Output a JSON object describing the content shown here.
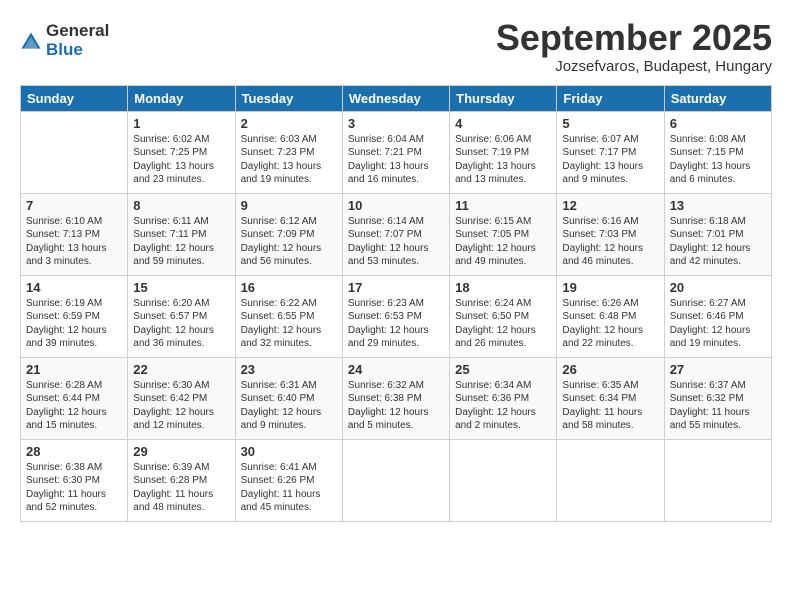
{
  "logo": {
    "general": "General",
    "blue": "Blue"
  },
  "title": "September 2025",
  "location": "Jozsefvaros, Budapest, Hungary",
  "header_days": [
    "Sunday",
    "Monday",
    "Tuesday",
    "Wednesday",
    "Thursday",
    "Friday",
    "Saturday"
  ],
  "weeks": [
    [
      {
        "day": "",
        "data": ""
      },
      {
        "day": "1",
        "data": "Sunrise: 6:02 AM\nSunset: 7:25 PM\nDaylight: 13 hours\nand 23 minutes."
      },
      {
        "day": "2",
        "data": "Sunrise: 6:03 AM\nSunset: 7:23 PM\nDaylight: 13 hours\nand 19 minutes."
      },
      {
        "day": "3",
        "data": "Sunrise: 6:04 AM\nSunset: 7:21 PM\nDaylight: 13 hours\nand 16 minutes."
      },
      {
        "day": "4",
        "data": "Sunrise: 6:06 AM\nSunset: 7:19 PM\nDaylight: 13 hours\nand 13 minutes."
      },
      {
        "day": "5",
        "data": "Sunrise: 6:07 AM\nSunset: 7:17 PM\nDaylight: 13 hours\nand 9 minutes."
      },
      {
        "day": "6",
        "data": "Sunrise: 6:08 AM\nSunset: 7:15 PM\nDaylight: 13 hours\nand 6 minutes."
      }
    ],
    [
      {
        "day": "7",
        "data": "Sunrise: 6:10 AM\nSunset: 7:13 PM\nDaylight: 13 hours\nand 3 minutes."
      },
      {
        "day": "8",
        "data": "Sunrise: 6:11 AM\nSunset: 7:11 PM\nDaylight: 12 hours\nand 59 minutes."
      },
      {
        "day": "9",
        "data": "Sunrise: 6:12 AM\nSunset: 7:09 PM\nDaylight: 12 hours\nand 56 minutes."
      },
      {
        "day": "10",
        "data": "Sunrise: 6:14 AM\nSunset: 7:07 PM\nDaylight: 12 hours\nand 53 minutes."
      },
      {
        "day": "11",
        "data": "Sunrise: 6:15 AM\nSunset: 7:05 PM\nDaylight: 12 hours\nand 49 minutes."
      },
      {
        "day": "12",
        "data": "Sunrise: 6:16 AM\nSunset: 7:03 PM\nDaylight: 12 hours\nand 46 minutes."
      },
      {
        "day": "13",
        "data": "Sunrise: 6:18 AM\nSunset: 7:01 PM\nDaylight: 12 hours\nand 42 minutes."
      }
    ],
    [
      {
        "day": "14",
        "data": "Sunrise: 6:19 AM\nSunset: 6:59 PM\nDaylight: 12 hours\nand 39 minutes."
      },
      {
        "day": "15",
        "data": "Sunrise: 6:20 AM\nSunset: 6:57 PM\nDaylight: 12 hours\nand 36 minutes."
      },
      {
        "day": "16",
        "data": "Sunrise: 6:22 AM\nSunset: 6:55 PM\nDaylight: 12 hours\nand 32 minutes."
      },
      {
        "day": "17",
        "data": "Sunrise: 6:23 AM\nSunset: 6:53 PM\nDaylight: 12 hours\nand 29 minutes."
      },
      {
        "day": "18",
        "data": "Sunrise: 6:24 AM\nSunset: 6:50 PM\nDaylight: 12 hours\nand 26 minutes."
      },
      {
        "day": "19",
        "data": "Sunrise: 6:26 AM\nSunset: 6:48 PM\nDaylight: 12 hours\nand 22 minutes."
      },
      {
        "day": "20",
        "data": "Sunrise: 6:27 AM\nSunset: 6:46 PM\nDaylight: 12 hours\nand 19 minutes."
      }
    ],
    [
      {
        "day": "21",
        "data": "Sunrise: 6:28 AM\nSunset: 6:44 PM\nDaylight: 12 hours\nand 15 minutes."
      },
      {
        "day": "22",
        "data": "Sunrise: 6:30 AM\nSunset: 6:42 PM\nDaylight: 12 hours\nand 12 minutes."
      },
      {
        "day": "23",
        "data": "Sunrise: 6:31 AM\nSunset: 6:40 PM\nDaylight: 12 hours\nand 9 minutes."
      },
      {
        "day": "24",
        "data": "Sunrise: 6:32 AM\nSunset: 6:38 PM\nDaylight: 12 hours\nand 5 minutes."
      },
      {
        "day": "25",
        "data": "Sunrise: 6:34 AM\nSunset: 6:36 PM\nDaylight: 12 hours\nand 2 minutes."
      },
      {
        "day": "26",
        "data": "Sunrise: 6:35 AM\nSunset: 6:34 PM\nDaylight: 11 hours\nand 58 minutes."
      },
      {
        "day": "27",
        "data": "Sunrise: 6:37 AM\nSunset: 6:32 PM\nDaylight: 11 hours\nand 55 minutes."
      }
    ],
    [
      {
        "day": "28",
        "data": "Sunrise: 6:38 AM\nSunset: 6:30 PM\nDaylight: 11 hours\nand 52 minutes."
      },
      {
        "day": "29",
        "data": "Sunrise: 6:39 AM\nSunset: 6:28 PM\nDaylight: 11 hours\nand 48 minutes."
      },
      {
        "day": "30",
        "data": "Sunrise: 6:41 AM\nSunset: 6:26 PM\nDaylight: 11 hours\nand 45 minutes."
      },
      {
        "day": "",
        "data": ""
      },
      {
        "day": "",
        "data": ""
      },
      {
        "day": "",
        "data": ""
      },
      {
        "day": "",
        "data": ""
      }
    ]
  ]
}
